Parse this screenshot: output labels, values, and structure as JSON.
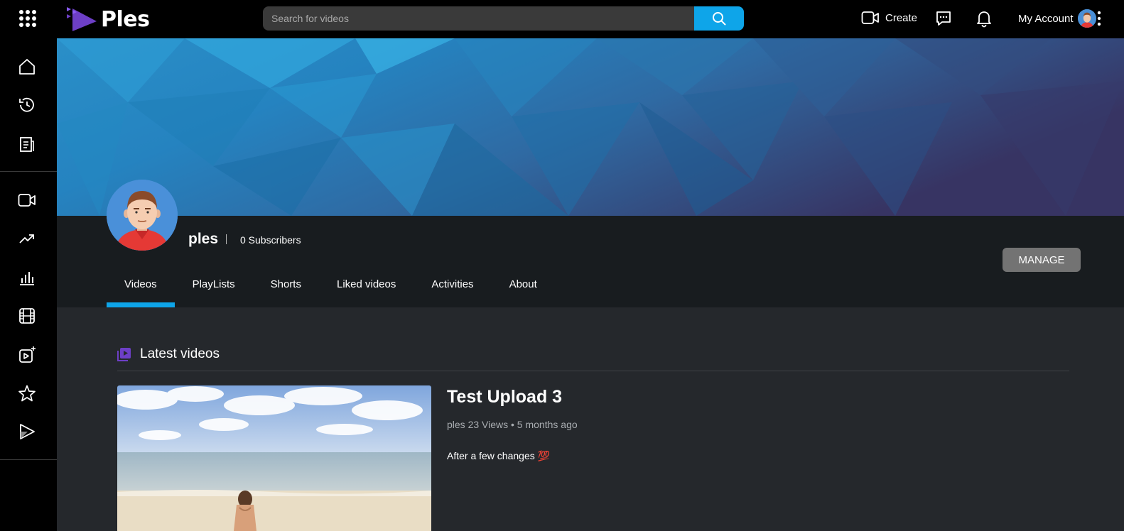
{
  "header": {
    "logo_text": "Ples",
    "search_placeholder": "Search for videos",
    "create_label": "Create",
    "account_label": "My Account"
  },
  "sidebar": {
    "items": [
      {
        "name": "home-icon"
      },
      {
        "name": "history-icon"
      },
      {
        "name": "playlist-icon"
      },
      {
        "name": "video-camera-icon"
      },
      {
        "name": "trending-icon"
      },
      {
        "name": "analytics-icon"
      },
      {
        "name": "film-icon"
      },
      {
        "name": "add-video-icon"
      },
      {
        "name": "star-icon"
      },
      {
        "name": "ples-play-icon"
      }
    ]
  },
  "channel": {
    "name": "ples",
    "subscribers": "0 Subscribers",
    "manage_label": "MANAGE",
    "tabs": [
      {
        "label": "Videos",
        "active": true
      },
      {
        "label": "PlayLists"
      },
      {
        "label": "Shorts"
      },
      {
        "label": "Liked videos"
      },
      {
        "label": "Activities"
      },
      {
        "label": "About"
      }
    ]
  },
  "latest": {
    "title": "Latest videos",
    "video": {
      "title": "Test Upload 3",
      "meta": "ples 23 Views • 5 months ago",
      "description": "After a few changes 💯"
    }
  },
  "colors": {
    "accent": "#0ea5e9",
    "brand_purple": "#6d3fc6",
    "topbar": "#000000",
    "header_bg": "#181c1f",
    "page_bg": "#25282c"
  }
}
